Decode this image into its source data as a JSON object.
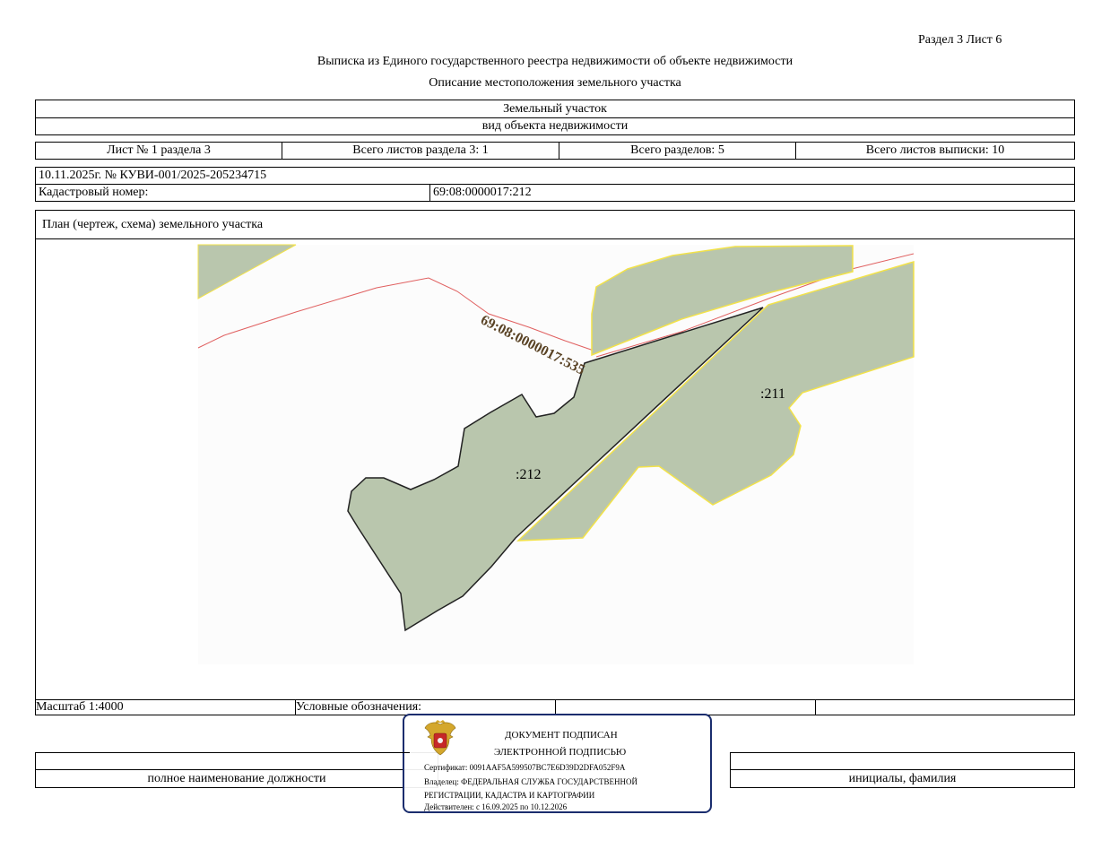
{
  "header": {
    "section_sheet": "Раздел 3    Лист 6",
    "title": "Выписка из Единого государственного реестра недвижимости об объекте недвижимости",
    "subtitle": "Описание местоположения земельного участка"
  },
  "object": {
    "type_value": "Земельный участок",
    "type_caption": "вид объекта недвижимости"
  },
  "sheets": {
    "sheet_no": "Лист № 1 раздела 3",
    "sheets_in_section": "Всего листов раздела 3: 1",
    "sections_total": "Всего разделов: 5",
    "sheets_total": "Всего листов выписки: 10"
  },
  "doc": {
    "date_number": "10.11.2025г. № КУВИ-001/2025-205234715",
    "cadastral_label": "Кадастровый номер:",
    "cadastral_value": "69:08:0000017:212"
  },
  "plan": {
    "title": "План (чертеж, схема) земельного участка",
    "label_road": "69:08:0000017:535",
    "label_212": ":212",
    "label_211": ":211",
    "colors": {
      "parcel_fill": "#b9c6ad",
      "parcel_edge_yellow": "#f2e24a",
      "boundary_red": "#e06060",
      "label_brown": "#5a4325"
    }
  },
  "footer": {
    "scale": "Масштаб 1:4000",
    "legend_label": "Условные обозначения:",
    "position_caption": "полное наименование должности",
    "name_caption": "инициалы, фамилия"
  },
  "stamp": {
    "line1": "ДОКУМЕНТ ПОДПИСАН",
    "line2": "ЭЛЕКТРОННОЙ ПОДПИСЬЮ",
    "certificate": "Сертификат: 0091AAF5A599507BC7E6D39D2DFA052F9A",
    "owner_line1": "Владелец: ФЕДЕРАЛЬНАЯ СЛУЖБА ГОСУДАРСТВЕННОЙ",
    "owner_line2": "РЕГИСТРАЦИИ, КАДАСТРА И КАРТОГРАФИИ",
    "valid": "Действителен: с 16.09.2025 по 10.12.2026",
    "emblem_icon": "coat-of-arms-icon",
    "border_color": "#1a2d6e"
  }
}
